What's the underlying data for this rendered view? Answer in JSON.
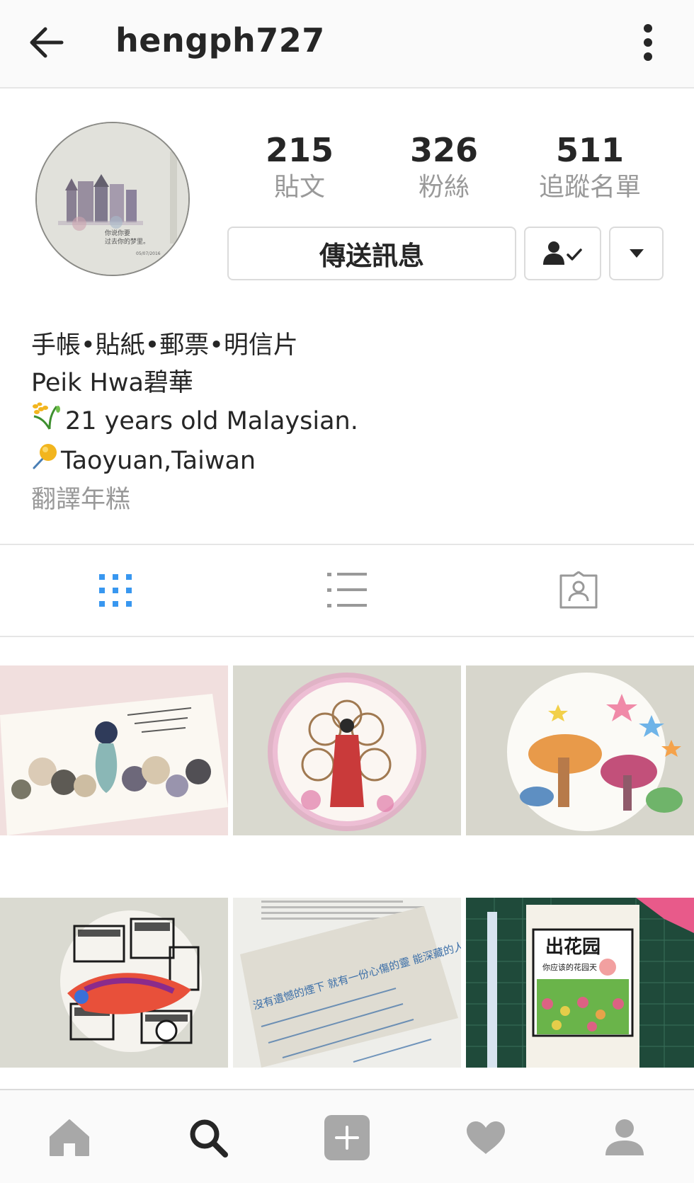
{
  "header": {
    "username": "hengph727"
  },
  "stats": {
    "posts": {
      "count": "215",
      "label": "貼文"
    },
    "followers": {
      "count": "326",
      "label": "粉絲"
    },
    "following": {
      "count": "511",
      "label": "追蹤名單"
    }
  },
  "actions": {
    "message_label": "傳送訊息"
  },
  "avatar": {
    "caption_line1": "你说你要",
    "caption_line2": "过去你的梦里。",
    "signature": "05/07/2016"
  },
  "bio": {
    "line1": "手帳•貼紙•郵票•明信片",
    "line2": "Peik Hwa碧華",
    "line3": "21 years old Malaysian.",
    "line4": "Taoyuan,Taiwan",
    "translate": "翻譯年糕"
  },
  "photos": {
    "p5_text": "沒有遺憾的煙下 就有一份心傷的靈 能深藏的人依舊守著 也沒捨棄的初衷 陳華心美醉的初衷",
    "p6_title": "出花园",
    "p6_subtitle": "你应该的花园天"
  },
  "icons": {
    "back": "arrow-left-icon",
    "more": "kebab-menu-icon",
    "following": "person-check-icon",
    "dropdown": "triangle-down-icon",
    "grid": "grid-view-icon",
    "list": "list-view-icon",
    "tagged": "tagged-person-icon",
    "home": "home-icon",
    "search": "search-icon",
    "add": "add-post-icon",
    "activity": "heart-icon",
    "profile": "profile-icon"
  },
  "colors": {
    "accent_blue": "#3897f0",
    "muted_gray": "#999999",
    "text": "#262626",
    "nav_gray": "#a8a8a8"
  }
}
